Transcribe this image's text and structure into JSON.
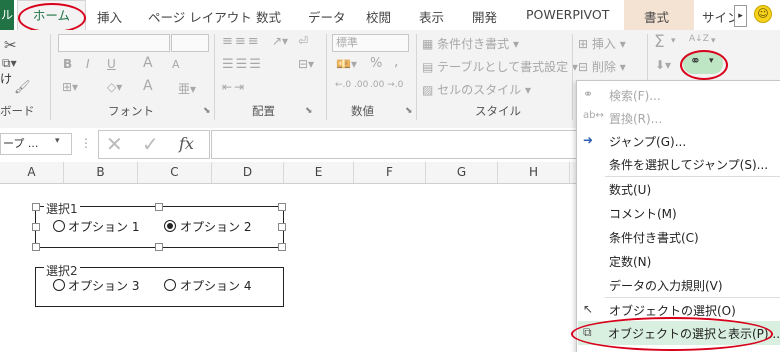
{
  "tabs": {
    "file": "ル",
    "home": "ホーム",
    "insert": "挿入",
    "page_layout": "ページ レイアウト",
    "formulas": "数式",
    "data": "データ",
    "review": "校閲",
    "view": "表示",
    "developer": "開発",
    "powerpivot": "POWERPIVOT",
    "format": "書式",
    "signin": "サイン"
  },
  "ribbon": {
    "clipboard": {
      "paste_frag": "け",
      "label": "ボード"
    },
    "font": {
      "bold": "B",
      "italic": "I",
      "underline": "U",
      "grow": "A",
      "shrink": "A",
      "color": "A",
      "label": "フォント"
    },
    "alignment": {
      "label": "配置"
    },
    "number": {
      "format": "標準",
      "percent": "%",
      "comma": ",",
      "inc": "←.0 .00",
      "dec": ".00 →.0",
      "label": "数値"
    },
    "styles": {
      "cond": "条件付き書式",
      "table": "テーブルとして書式設定",
      "cell": "セルのスタイル",
      "label": "スタイル"
    },
    "cells": {
      "insert": "挿入",
      "delete": "削除"
    },
    "editing": {
      "sigma": "Σ",
      "sort": "A↓Z"
    }
  },
  "formula_bar": {
    "name_box": "ープ ...",
    "fx": "fx"
  },
  "columns": [
    "A",
    "B",
    "C",
    "D",
    "E",
    "F",
    "G",
    "H"
  ],
  "sheet": {
    "group1": {
      "title": "選択1",
      "opt1": "オプション 1",
      "opt2": "オプション 2"
    },
    "group2": {
      "title": "選択2",
      "opt3": "オプション 3",
      "opt4": "オプション 4"
    }
  },
  "menu": {
    "find": "検索(F)...",
    "replace": "置換(R)...",
    "goto": "ジャンプ(G)...",
    "goto_special": "条件を選択してジャンプ(S)...",
    "formulas": "数式(U)",
    "comments": "コメント(M)",
    "conditional": "条件付き書式(C)",
    "constants": "定数(N)",
    "validation": "データの入力規則(V)",
    "select_objects": "オブジェクトの選択(O)",
    "selection_pane": "オブジェクトの選択と表示(P)..."
  },
  "colors": {
    "excel_green": "#217346",
    "highlight_red": "#d9001b",
    "hover_green": "#d9efdf"
  }
}
